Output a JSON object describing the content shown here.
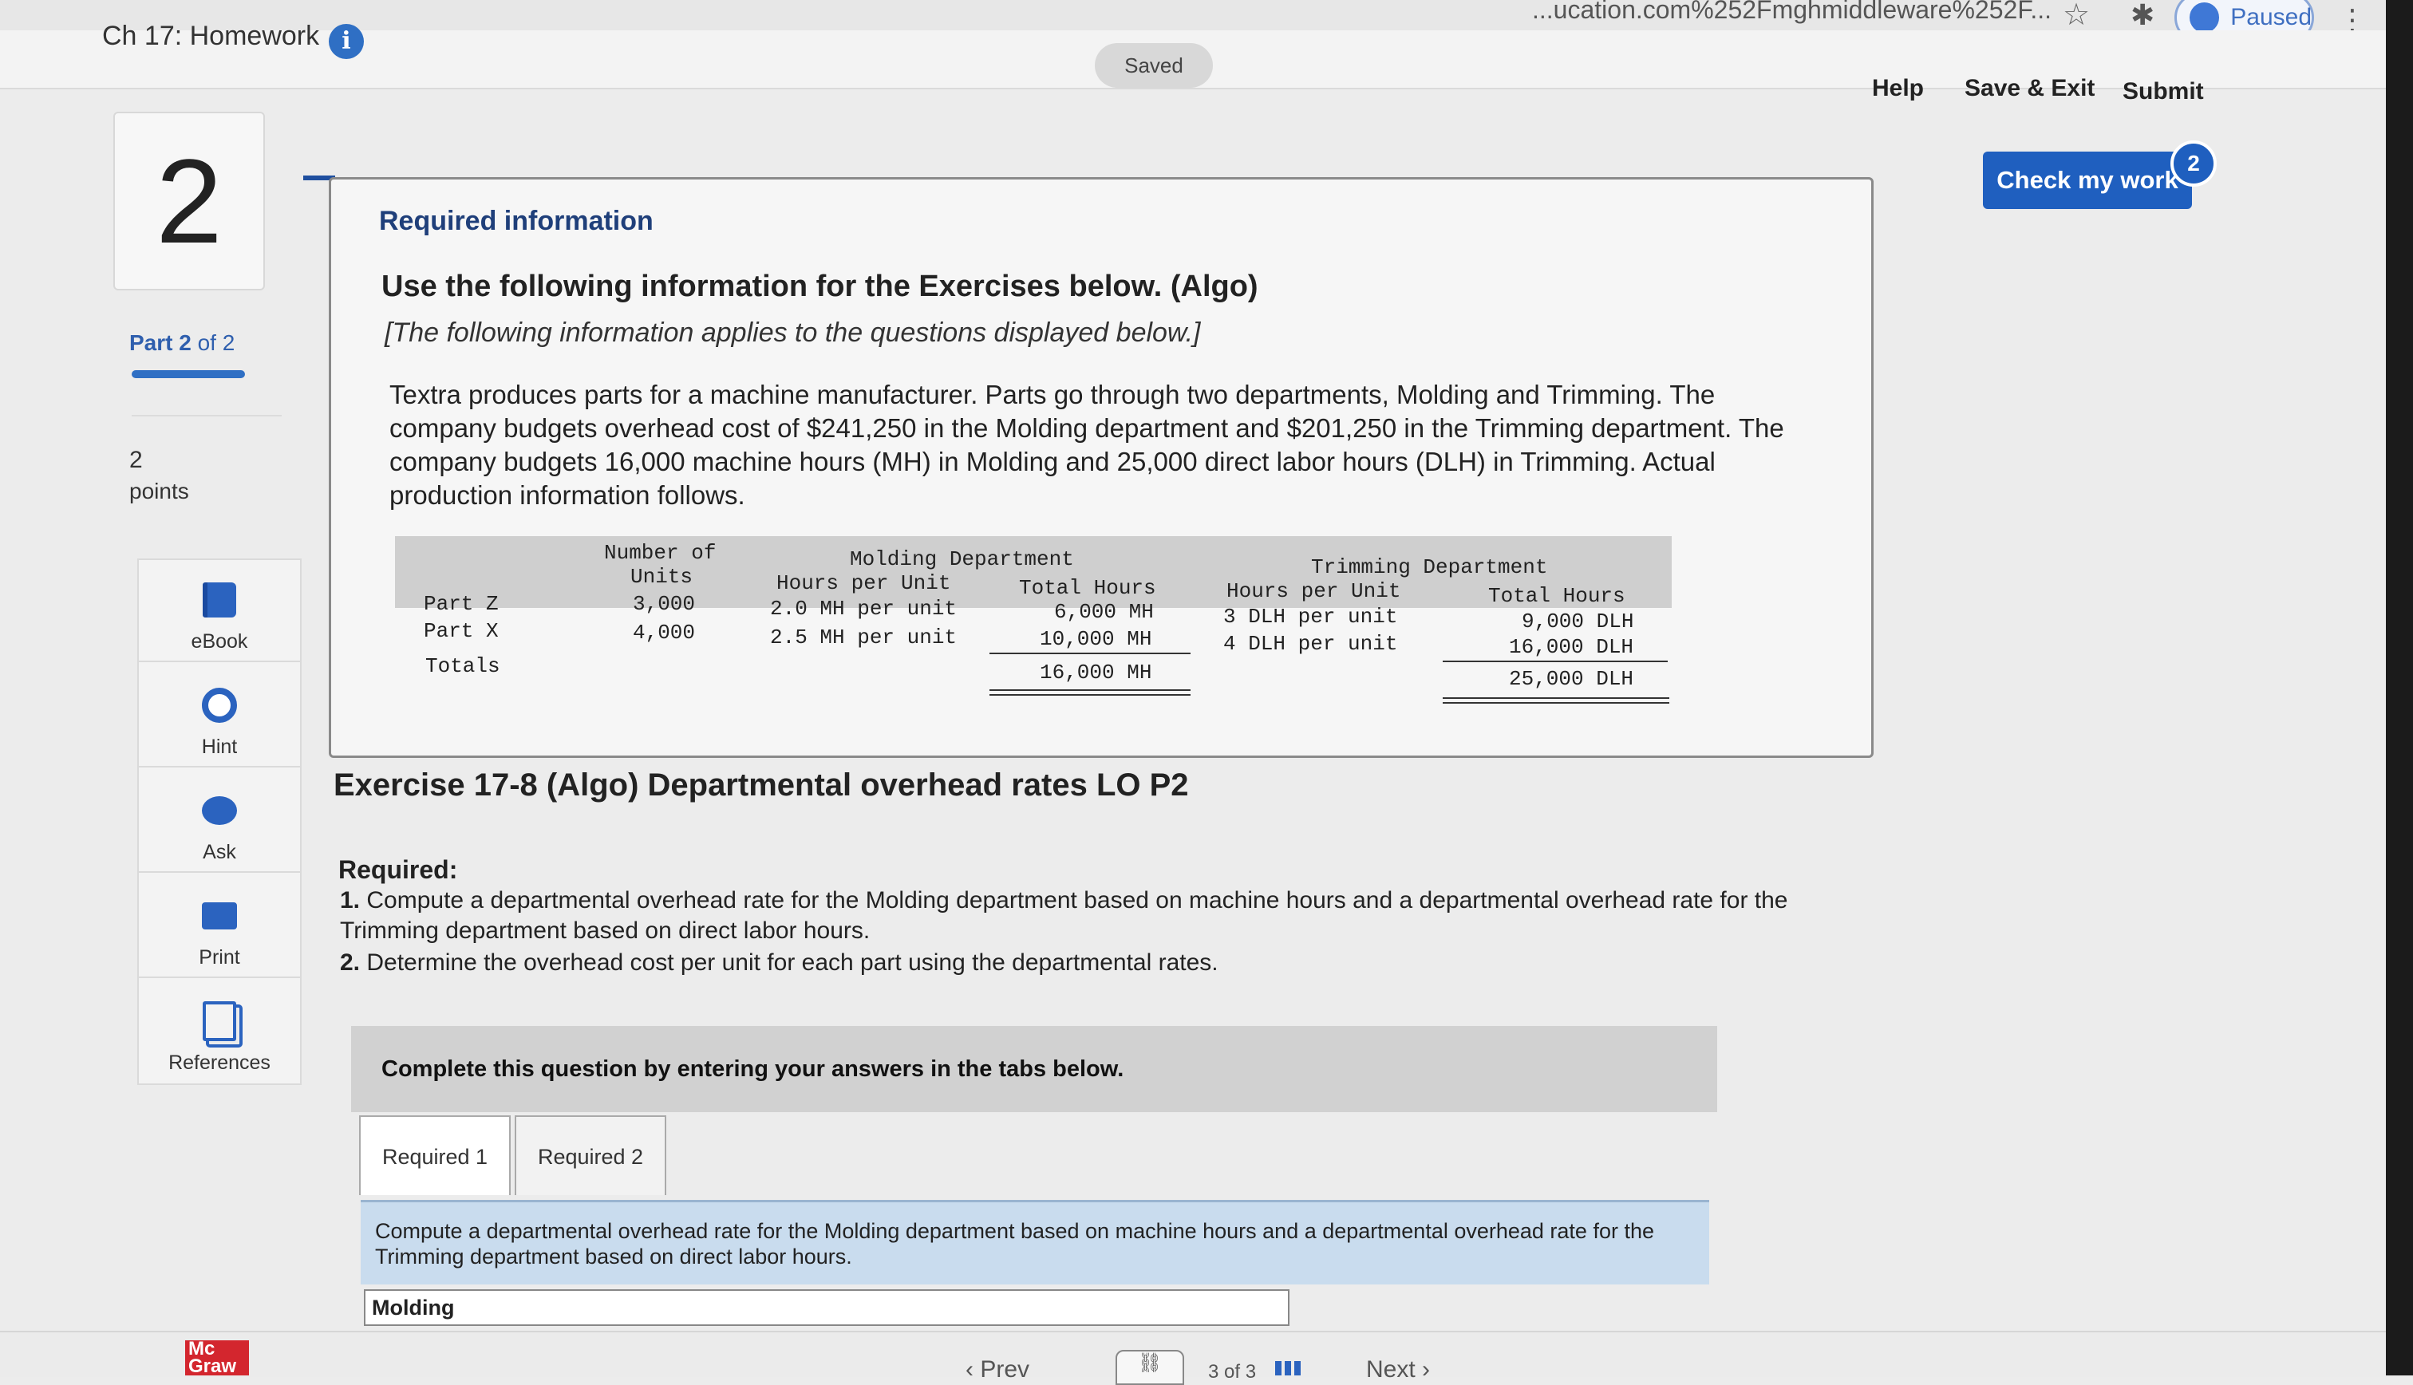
{
  "browser": {
    "url_fragment": "...ucation.com%252Fmghmiddleware%252F...",
    "profile_status": "Paused"
  },
  "header": {
    "title": "Ch 17: Homework",
    "saved": "Saved",
    "help": "Help",
    "save_exit": "Save & Exit",
    "submit": "Submit",
    "check_my_work": "Check my work",
    "check_badge": "2"
  },
  "sidebar": {
    "question_number": "2",
    "part_bold": "Part 2",
    "part_rest": " of 2",
    "points": "2",
    "points_label": "points",
    "tools": [
      {
        "label": "eBook",
        "icon": "ebook-icon"
      },
      {
        "label": "Hint",
        "icon": "hint-icon"
      },
      {
        "label": "Ask",
        "icon": "ask-icon"
      },
      {
        "label": "Print",
        "icon": "print-icon"
      },
      {
        "label": "References",
        "icon": "references-icon"
      }
    ]
  },
  "info": {
    "heading": "Required information",
    "subheading": "Use the following information for the Exercises below. (Algo)",
    "applies": "[The following information applies to the questions displayed below.]",
    "paragraph": "Textra produces parts for a machine manufacturer. Parts go through two departments, Molding and Trimming. The company budgets overhead cost of $241,250 in the Molding department and $201,250 in the Trimming department. The company budgets 16,000 machine hours (MH) in Molding and 25,000 direct labor hours (DLH) in Trimming. Actual production information follows."
  },
  "table": {
    "h_units_1": "Number of",
    "h_units_2": "Units",
    "h_molding": "Molding Department",
    "h_trimming": "Trimming Department",
    "h_hpu_m": "Hours per Unit",
    "h_total_m": "Total Hours",
    "h_hpu_t": "Hours per Unit",
    "h_total_t": "Total Hours",
    "rows": [
      {
        "part": "Part Z",
        "units": "3,000",
        "m_rate": "2.0 MH per unit",
        "m_total": "6,000 MH",
        "t_rate": "3 DLH per unit",
        "t_total": "9,000 DLH"
      },
      {
        "part": "Part X",
        "units": "4,000",
        "m_rate": "2.5 MH per unit",
        "m_total": "10,000 MH",
        "t_rate": "4 DLH per unit",
        "t_total": "16,000 DLH"
      }
    ],
    "totals_label": "Totals",
    "totals_m": "16,000 MH",
    "totals_t": "25,000 DLH"
  },
  "exercise": {
    "title": "Exercise 17-8 (Algo) Departmental overhead rates LO P2",
    "required": "Required:",
    "item1_num": "1.",
    "item1": " Compute a departmental overhead rate for the Molding department based on machine hours and a departmental overhead rate for the Trimming department based on direct labor hours.",
    "item2_num": "2.",
    "item2": " Determine the overhead cost per unit for each part using the departmental rates."
  },
  "answer": {
    "complete_msg": "Complete this question by entering your answers in the tabs below.",
    "tabs": [
      "Required 1",
      "Required 2"
    ],
    "instruction": "Compute a departmental overhead rate for the Molding department based on machine hours and a departmental overhead rate for the Trimming department based on direct labor hours.",
    "field_label": "Molding"
  },
  "footer": {
    "logo": "Mc Graw",
    "prev": "Prev",
    "next": "Next",
    "pager": "3 of 3"
  }
}
